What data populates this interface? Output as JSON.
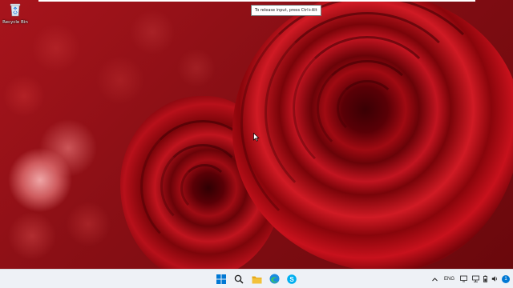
{
  "desktop": {
    "icons": [
      {
        "label": "Recycle Bin",
        "icon": "recycle-bin-icon"
      }
    ]
  },
  "tooltip": {
    "text": "To release input, press Ctrl+Alt"
  },
  "taskbar": {
    "pinned": [
      {
        "name": "start",
        "icon": "windows-logo-icon"
      },
      {
        "name": "search",
        "icon": "search-icon"
      },
      {
        "name": "file-explorer",
        "icon": "folder-icon"
      },
      {
        "name": "edge",
        "icon": "edge-browser-icon"
      },
      {
        "name": "skype",
        "icon": "skype-icon"
      }
    ],
    "tray": {
      "overflow_icon": "chevron-up-icon",
      "language": "ENG",
      "icons": [
        "display-icon",
        "network-icon",
        "battery-icon",
        "volume-icon"
      ],
      "notification_count": "1"
    }
  },
  "colors": {
    "taskbar_bg": "#eef1f6",
    "windows_blue": "#0078d4",
    "folder_yellow": "#f3c13a",
    "skype_blue": "#00aff0"
  }
}
